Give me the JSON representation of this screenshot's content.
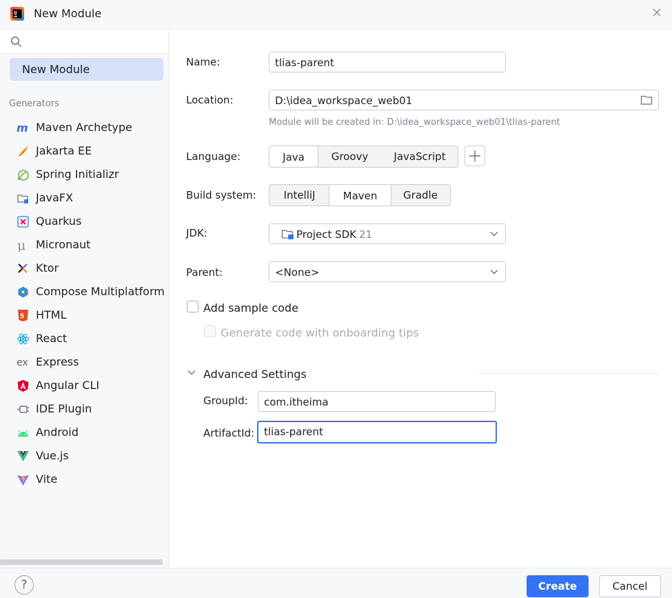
{
  "window": {
    "title": "New Module"
  },
  "sidebar": {
    "search_placeholder": "",
    "selected_item": "New Module",
    "generators_header": "Generators",
    "generators": [
      {
        "label": "Maven Archetype",
        "icon": "maven-icon"
      },
      {
        "label": "Jakarta EE",
        "icon": "jakarta-ee-icon"
      },
      {
        "label": "Spring Initializr",
        "icon": "spring-icon"
      },
      {
        "label": "JavaFX",
        "icon": "javafx-icon"
      },
      {
        "label": "Quarkus",
        "icon": "quarkus-icon"
      },
      {
        "label": "Micronaut",
        "icon": "micronaut-icon"
      },
      {
        "label": "Ktor",
        "icon": "ktor-icon"
      },
      {
        "label": "Compose Multiplatform",
        "icon": "compose-icon"
      },
      {
        "label": "HTML",
        "icon": "html5-icon"
      },
      {
        "label": "React",
        "icon": "react-icon"
      },
      {
        "label": "Express",
        "icon": "express-icon"
      },
      {
        "label": "Angular CLI",
        "icon": "angular-icon"
      },
      {
        "label": "IDE Plugin",
        "icon": "plugin-icon"
      },
      {
        "label": "Android",
        "icon": "android-icon"
      },
      {
        "label": "Vue.js",
        "icon": "vue-icon"
      },
      {
        "label": "Vite",
        "icon": "vite-icon"
      }
    ]
  },
  "form": {
    "name_label": "Name:",
    "name_value": "tlias-parent",
    "location_label": "Location:",
    "location_value": "D:\\idea_workspace_web01",
    "location_hint": "Module will be created in: D:\\idea_workspace_web01\\tlias-parent",
    "language_label": "Language:",
    "languages": [
      "Java",
      "Groovy",
      "JavaScript"
    ],
    "language_selected": "Java",
    "build_label": "Build system:",
    "build_systems": [
      "IntelliJ",
      "Maven",
      "Gradle"
    ],
    "build_selected": "Maven",
    "jdk_label": "JDK:",
    "jdk_value": "Project SDK",
    "jdk_version": "21",
    "parent_label": "Parent:",
    "parent_value": "<None>",
    "sample_code_label": "Add sample code",
    "sample_code_checked": false,
    "onboarding_label": "Generate code with onboarding tips",
    "onboarding_checked": false,
    "advanced_label": "Advanced Settings",
    "groupid_label": "GroupId:",
    "groupid_value": "com.itheima",
    "artifactid_label": "ArtifactId:",
    "artifactid_value": "tlias-parent"
  },
  "footer": {
    "help_label": "?",
    "create_label": "Create",
    "cancel_label": "Cancel"
  },
  "colors": {
    "accent": "#3574f0",
    "selection": "#d5e1f8"
  }
}
